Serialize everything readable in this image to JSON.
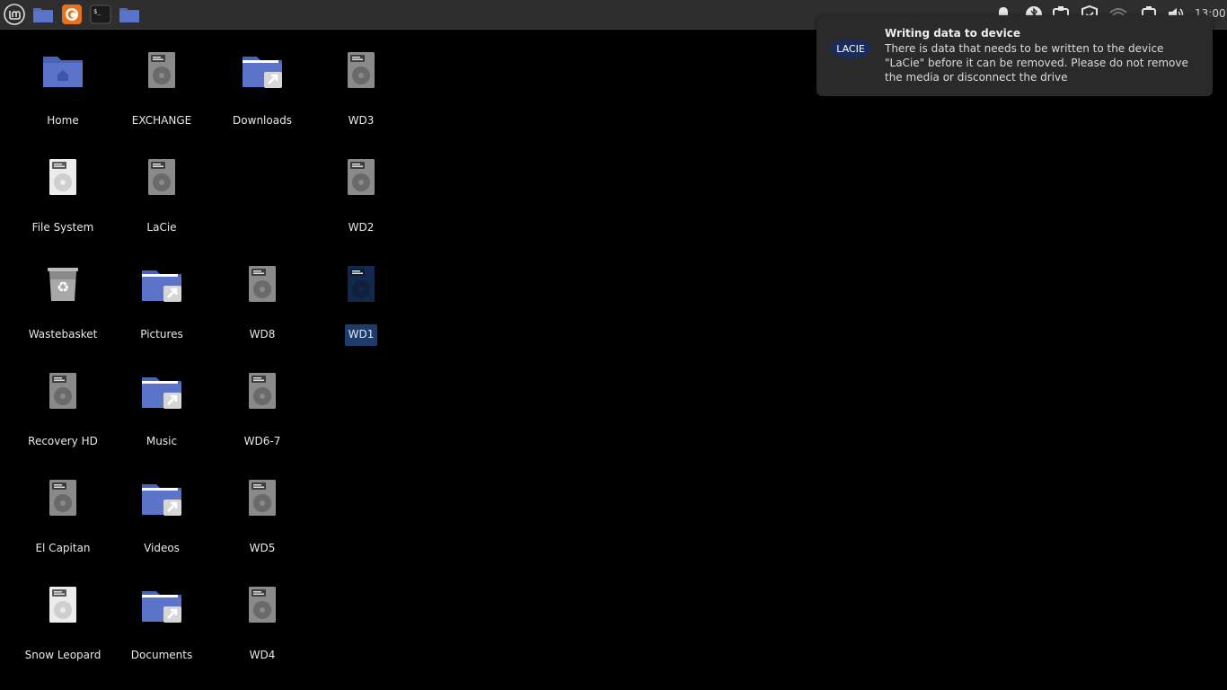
{
  "panel": {
    "launchers": [
      {
        "name": "mint-menu-icon"
      },
      {
        "name": "files-icon"
      },
      {
        "name": "firefox-icon"
      },
      {
        "name": "terminal-icon"
      },
      {
        "name": "folder-icon"
      }
    ],
    "clock": "13:00"
  },
  "desktop": {
    "icons": [
      {
        "label": "Home",
        "type": "home-folder"
      },
      {
        "label": "EXCHANGE",
        "type": "drive"
      },
      {
        "label": "Downloads",
        "type": "folder-link"
      },
      {
        "label": "WD3",
        "type": "drive"
      },
      {
        "label": "File System",
        "type": "drive-white"
      },
      {
        "label": "LaCie",
        "type": "drive"
      },
      {
        "label": "WD2",
        "type": "drive"
      },
      {
        "label": "Wastebasket",
        "type": "trash"
      },
      {
        "label": "Pictures",
        "type": "folder-link"
      },
      {
        "label": "WD8",
        "type": "drive"
      },
      {
        "label": "WD1",
        "type": "drive-selected"
      },
      {
        "label": "Recovery HD",
        "type": "drive"
      },
      {
        "label": "Music",
        "type": "folder-link"
      },
      {
        "label": "WD6-7",
        "type": "drive"
      },
      {
        "label": "El Capitan",
        "type": "drive"
      },
      {
        "label": "Videos",
        "type": "folder-link"
      },
      {
        "label": "WD5",
        "type": "drive"
      },
      {
        "label": "Snow Leopard",
        "type": "drive-white"
      },
      {
        "label": "Documents",
        "type": "folder-link"
      },
      {
        "label": "WD4",
        "type": "drive"
      }
    ]
  },
  "notification": {
    "logo_text": "LACIE",
    "title": "Writing data to device",
    "body": "There is data that needs to be written to the device \"LaCie\" before it can be removed. Please do not remove the media or disconnect the drive"
  },
  "colors": {
    "folder": "#5b73c9",
    "drive": "#8a8a8a",
    "selected": "#1d3b6b"
  }
}
